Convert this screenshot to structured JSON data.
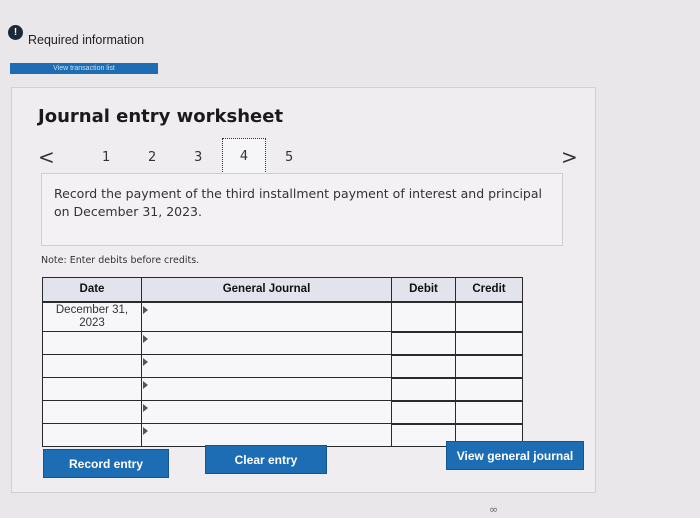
{
  "header": {
    "info_icon": "!",
    "required_text": "Required information",
    "tx_list_button": "View transaction list"
  },
  "worksheet": {
    "title": "Journal entry worksheet",
    "nav": {
      "prev": "<",
      "pages": [
        "1",
        "2",
        "3",
        "4",
        "5"
      ],
      "current_page": "4",
      "next": ">"
    },
    "instruction": "Record the payment of the third installment payment of interest and principal on December 31, 2023.",
    "note": "Note: Enter debits before credits.",
    "table": {
      "headers": [
        "Date",
        "General Journal",
        "Debit",
        "Credit"
      ],
      "date_value": "December 31, 2023"
    },
    "buttons": {
      "record": "Record entry",
      "clear": "Clear entry",
      "view": "View general journal"
    }
  },
  "footer": {
    "link_icon": "link-icon"
  }
}
